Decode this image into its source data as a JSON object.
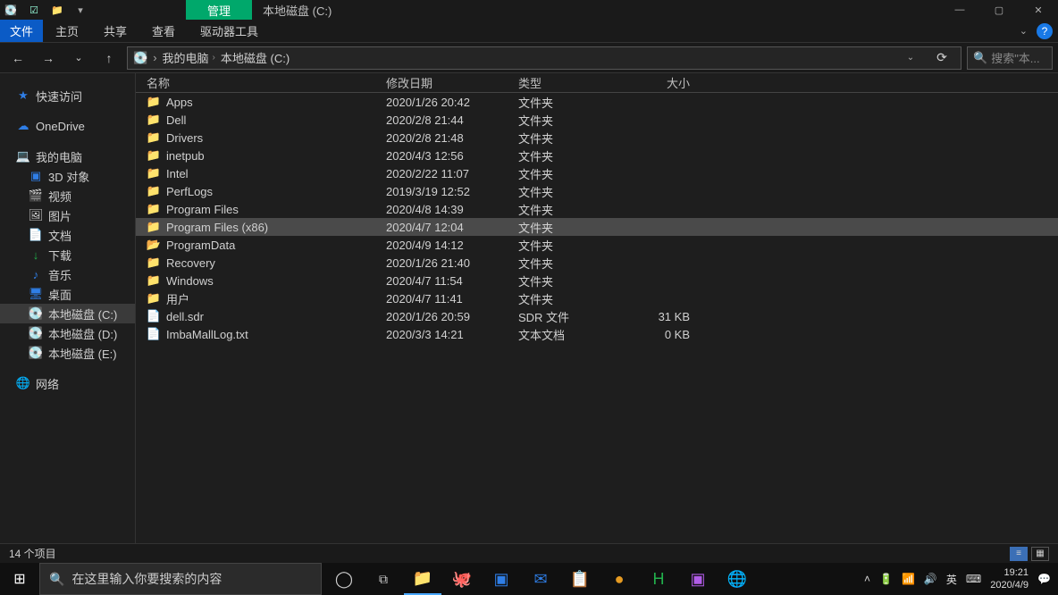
{
  "window": {
    "context_tab": "管理",
    "title": "本地磁盘 (C:)"
  },
  "ribbon": {
    "file": "文件",
    "tabs": [
      "主页",
      "共享",
      "查看",
      "驱动器工具"
    ]
  },
  "breadcrumbs": [
    "我的电脑",
    "本地磁盘 (C:)"
  ],
  "search_placeholder": "搜索\"本...",
  "nav": {
    "quick": "快速访问",
    "onedrive": "OneDrive",
    "thispc": "我的电脑",
    "items": [
      "3D 对象",
      "视频",
      "图片",
      "文档",
      "下载",
      "音乐",
      "桌面",
      "本地磁盘 (C:)",
      "本地磁盘 (D:)",
      "本地磁盘 (E:)"
    ],
    "network": "网络"
  },
  "columns": {
    "name": "名称",
    "date": "修改日期",
    "type": "类型",
    "size": "大小"
  },
  "rows": [
    {
      "icon": "folder",
      "name": "Apps",
      "date": "2020/1/26 20:42",
      "type": "文件夹",
      "size": ""
    },
    {
      "icon": "folder",
      "name": "Dell",
      "date": "2020/2/8 21:44",
      "type": "文件夹",
      "size": ""
    },
    {
      "icon": "folder",
      "name": "Drivers",
      "date": "2020/2/8 21:48",
      "type": "文件夹",
      "size": ""
    },
    {
      "icon": "folder",
      "name": "inetpub",
      "date": "2020/4/3 12:56",
      "type": "文件夹",
      "size": ""
    },
    {
      "icon": "folder",
      "name": "Intel",
      "date": "2020/2/22 11:07",
      "type": "文件夹",
      "size": ""
    },
    {
      "icon": "folder",
      "name": "PerfLogs",
      "date": "2019/3/19 12:52",
      "type": "文件夹",
      "size": ""
    },
    {
      "icon": "folder",
      "name": "Program Files",
      "date": "2020/4/8 14:39",
      "type": "文件夹",
      "size": ""
    },
    {
      "icon": "folder",
      "name": "Program Files (x86)",
      "date": "2020/4/7 12:04",
      "type": "文件夹",
      "size": "",
      "selected": true
    },
    {
      "icon": "folder-h",
      "name": "ProgramData",
      "date": "2020/4/9 14:12",
      "type": "文件夹",
      "size": ""
    },
    {
      "icon": "folder",
      "name": "Recovery",
      "date": "2020/1/26 21:40",
      "type": "文件夹",
      "size": ""
    },
    {
      "icon": "folder",
      "name": "Windows",
      "date": "2020/4/7 11:54",
      "type": "文件夹",
      "size": ""
    },
    {
      "icon": "folder",
      "name": "用户",
      "date": "2020/4/7 11:41",
      "type": "文件夹",
      "size": ""
    },
    {
      "icon": "file",
      "name": "dell.sdr",
      "date": "2020/1/26 20:59",
      "type": "SDR 文件",
      "size": "31 KB"
    },
    {
      "icon": "file",
      "name": "ImbaMallLog.txt",
      "date": "2020/3/3 14:21",
      "type": "文本文档",
      "size": "0 KB"
    }
  ],
  "status": "14 个项目",
  "taskbar": {
    "search_placeholder": "在这里输入你要搜索的内容",
    "ime": "英",
    "time": "19:21",
    "date": "2020/4/9"
  }
}
